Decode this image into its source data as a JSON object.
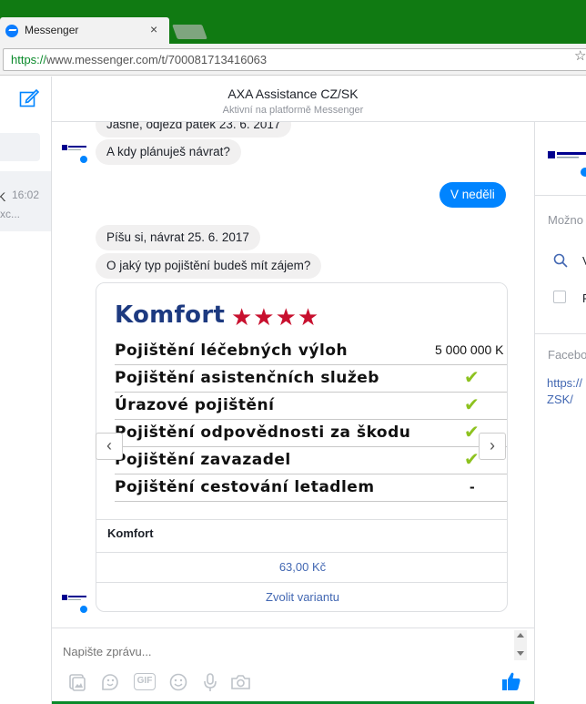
{
  "browser": {
    "tab_title": "Messenger",
    "tab_close": "×",
    "url_scheme": "https://",
    "url_rest": "www.messenger.com/t/700081713416063"
  },
  "left_pane": {
    "conversation_name": "K",
    "conversation_time": "16:02",
    "conversation_snippet": "xc..."
  },
  "header": {
    "title": "AXA Assistance CZ/SK",
    "subtitle": "Aktivní na platformě Messenger"
  },
  "messages": {
    "m1": "Jasně, odjezd pátek 23. 6. 2017",
    "m2": "A kdy plánuješ návrat?",
    "m3": "V neděli",
    "m4": "Píšu si, návrat 25. 6. 2017",
    "m5": "O jaký typ pojištění budeš mít zájem?"
  },
  "card": {
    "image_title": "Komfort",
    "stars": "★★★★",
    "star_rating": 4,
    "rows": [
      {
        "label": "Pojištění léčebných výloh",
        "value": "5 000 000 K"
      },
      {
        "label": "Pojištění asistenčních služeb",
        "mark": "✔"
      },
      {
        "label": "Úrazové pojištění",
        "mark": "✔"
      },
      {
        "label": "Pojištění odpovědnosti za škodu",
        "mark": "✔"
      },
      {
        "label": "Pojištění zavazadel",
        "mark": "✔"
      },
      {
        "label": "Pojištění cestování letadlem",
        "mark": "-"
      }
    ],
    "label": "Komfort",
    "price_button": "63,00 Kč",
    "choose_button": "Zvolit variantu",
    "prev_arrow": "‹",
    "next_arrow": "›"
  },
  "composer": {
    "placeholder": "Napište zprávu..."
  },
  "right_pane": {
    "options_heading": "Možno",
    "search_item": "V",
    "option_item": "P",
    "facebook_heading": "Facebo",
    "link_line1": "https://",
    "link_line2": "ZSK/"
  },
  "colors": {
    "chrome_green": "#107a12",
    "messenger_blue": "#0084ff",
    "link_blue": "#4267b2",
    "star_red": "#c8102e",
    "check_green": "#8dc21f",
    "komfort_blue": "#1d3a80"
  }
}
